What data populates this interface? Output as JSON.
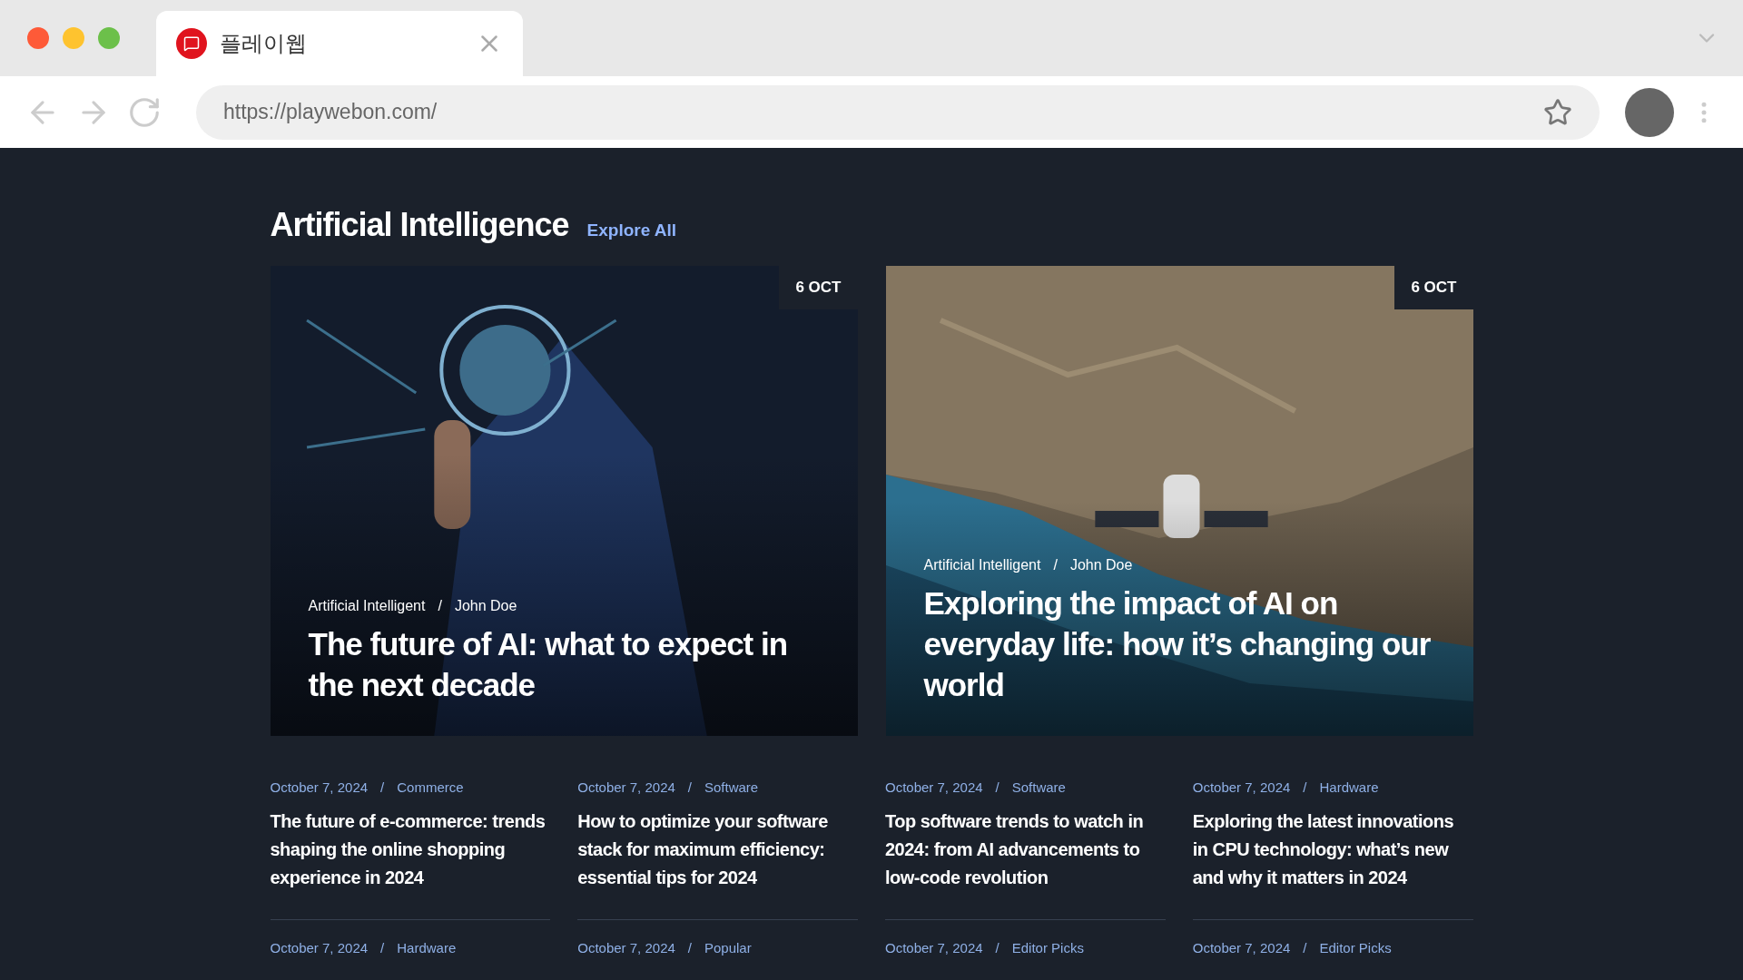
{
  "browser": {
    "tab_title": "플레이웹",
    "url": "https://playwebon.com/"
  },
  "section": {
    "title": "Artificial Intelligence",
    "link": "Explore All"
  },
  "featured": [
    {
      "date": "6 OCT",
      "category": "Artificial Intelligent",
      "separator": "/",
      "author": "John Doe",
      "title": "The future of AI: what to expect in the next decade"
    },
    {
      "date": "6 OCT",
      "category": "Artificial Intelligent",
      "separator": "/",
      "author": "John Doe",
      "title": "Exploring the impact of AI on everyday life: how it’s changing our world"
    }
  ],
  "posts": [
    {
      "date": "October 7, 2024",
      "separator": "/",
      "category": "Commerce",
      "title": "The future of e-commerce: trends shaping the online shopping experience in 2024"
    },
    {
      "date": "October 7, 2024",
      "separator": "/",
      "category": "Software",
      "title": "How to optimize your software stack for maximum efficiency: essential tips for 2024"
    },
    {
      "date": "October 7, 2024",
      "separator": "/",
      "category": "Software",
      "title": "Top software trends to watch in 2024: from AI advancements to low-code revolution"
    },
    {
      "date": "October 7, 2024",
      "separator": "/",
      "category": "Hardware",
      "title": "Exploring the latest innovations in CPU technology: what’s new and why it matters in 2024"
    },
    {
      "date": "October 7, 2024",
      "separator": "/",
      "category": "Hardware"
    },
    {
      "date": "October 7, 2024",
      "separator": "/",
      "category": "Popular"
    },
    {
      "date": "October 7, 2024",
      "separator": "/",
      "category": "Editor Picks"
    },
    {
      "date": "October 7, 2024",
      "separator": "/",
      "category": "Editor Picks"
    }
  ]
}
